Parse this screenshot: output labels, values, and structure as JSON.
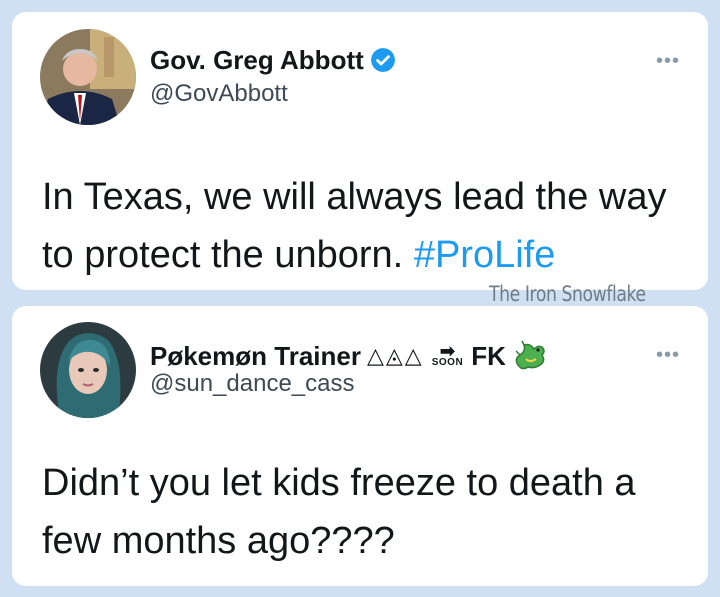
{
  "tweet1": {
    "name": "Gov. Greg Abbott",
    "handle": "@GovAbbott",
    "text_part1": "In Texas, we will always lead the way to protect the unborn. ",
    "hashtag": "#ProLife",
    "more_glyph": "•••",
    "avatar_icon": "portrait-avatar-icon",
    "verified_icon": "verified-badge-icon"
  },
  "watermark": "The Iron Snowflake",
  "tweet2": {
    "name_main": "Pøkemøn Trainer",
    "name_triangles": "△◬△",
    "soon_arrow": "➡",
    "soon_label": "SOON",
    "name_tail": "FK",
    "handle": "@sun_dance_cass",
    "text": "Didn’t you let kids freeze to death a few months ago????",
    "more_glyph": "•••",
    "avatar_icon": "portrait-avatar-icon",
    "dragon_icon": "green-dragon-emoji-icon"
  },
  "colors": {
    "background": "#cfe0f3",
    "card": "#ffffff",
    "hashtag": "#1d9bf0",
    "verified": "#1d9bf0"
  }
}
